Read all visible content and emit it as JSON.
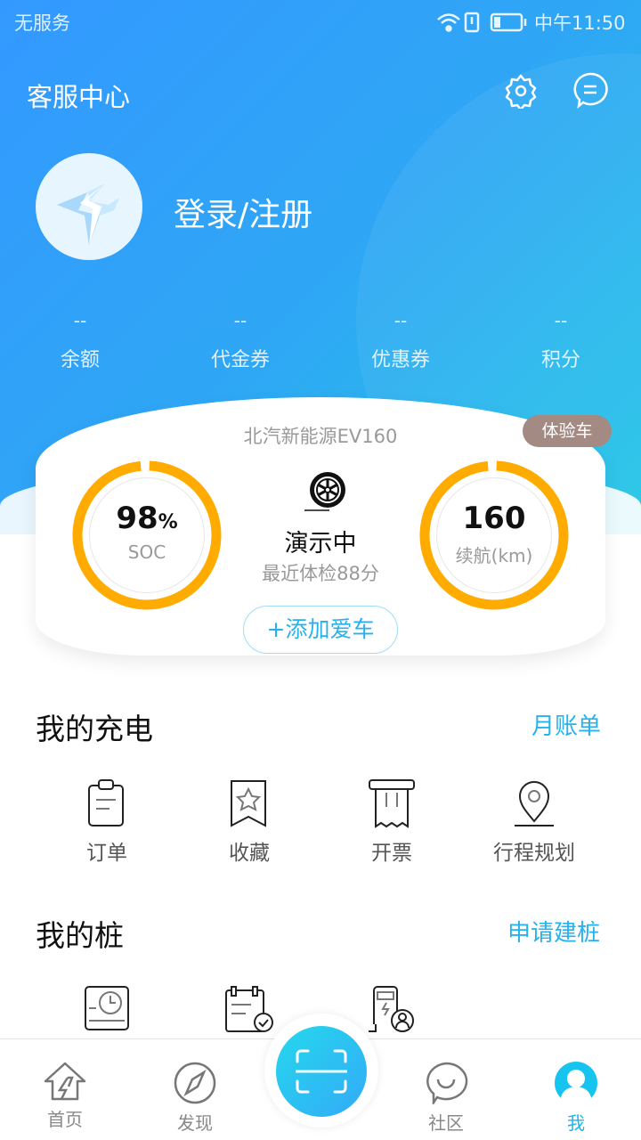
{
  "status_bar": {
    "carrier": "无服务",
    "time": "中午11:50",
    "battery_level": 0.2
  },
  "header": {
    "title": "客服中心",
    "icons": [
      "gear-icon",
      "message-icon"
    ]
  },
  "profile": {
    "login_label": "登录/注册"
  },
  "stats": [
    {
      "value": "--",
      "label": "余额"
    },
    {
      "value": "--",
      "label": "代金券"
    },
    {
      "value": "--",
      "label": "优惠券"
    },
    {
      "value": "--",
      "label": "积分"
    }
  ],
  "car": {
    "model": "北汽新能源EV160",
    "badge": "体验车",
    "soc_value": "98",
    "soc_unit": "%",
    "soc_label": "SOC",
    "soc_fraction": 0.98,
    "range_value": "160",
    "range_label": "续航(km)",
    "status": "演示中",
    "checkup": "最近体检88分",
    "add_label": "+添加爱车"
  },
  "colors": {
    "accent": "#27b1ee",
    "ring": "#ffab00",
    "badge": "#a38a82"
  },
  "charging": {
    "title": "我的充电",
    "link": "月账单",
    "items": [
      {
        "label": "订单",
        "icon": "clipboard-icon"
      },
      {
        "label": "收藏",
        "icon": "bookmark-star-icon"
      },
      {
        "label": "开票",
        "icon": "receipt-icon"
      },
      {
        "label": "行程规划",
        "icon": "map-pin-icon"
      }
    ]
  },
  "pile": {
    "title": "我的桩",
    "link": "申请建桩",
    "icons": [
      "pile-clock-icon",
      "calendar-check-icon",
      "charger-user-icon"
    ]
  },
  "tabs": [
    {
      "label": "首页"
    },
    {
      "label": "发现"
    },
    {
      "label": "社区"
    },
    {
      "label": "我",
      "active": true
    }
  ]
}
